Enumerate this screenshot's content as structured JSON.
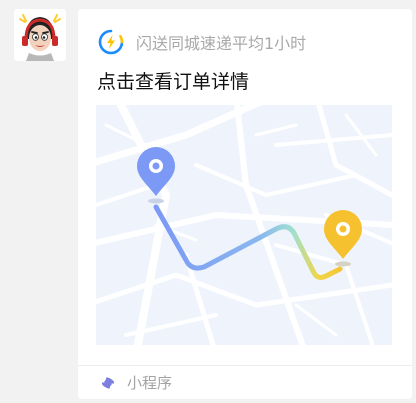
{
  "message": {
    "sender_avatar": "cartoon-avatar-with-headphones",
    "card": {
      "app_icon": "lightning-bolt-icon",
      "app_name": "闪送同城速递平均1小时",
      "title": "点击查看订单详情",
      "map": {
        "start_pin_color": "#7b99f5",
        "end_pin_color": "#f6c12e",
        "route_gradient": [
          "#7b99f5",
          "#8bd6d9",
          "#f0d64a",
          "#f6c12e"
        ]
      },
      "footer": {
        "icon": "mini-program-icon",
        "label": "小程序"
      }
    }
  },
  "colors": {
    "page_background": "#f2f2f2",
    "card_background": "#ffffff",
    "brand_blue": "#1a8cff",
    "brand_yellow": "#ffc400",
    "mini_program_purple": "#7c7fe0"
  }
}
